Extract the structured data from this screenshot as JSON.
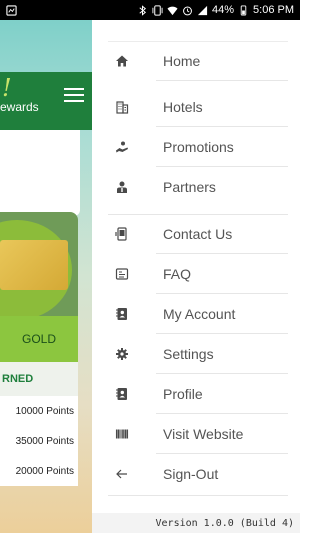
{
  "status_bar": {
    "battery": "44%",
    "time": "5:06 PM",
    "icons": [
      "notification-icon",
      "bluetooth-icon",
      "vibrate-icon",
      "wifi-icon",
      "alarm-icon",
      "signal-icon",
      "battery-icon"
    ]
  },
  "background": {
    "logo_text": "!",
    "brand_text": "ewards",
    "tier": "GOLD",
    "section_label": "RNED",
    "rows": [
      "10000 Points",
      "35000 Points",
      "20000 Points"
    ],
    "colors": {
      "header": "#1f7f3c",
      "tier": "#8cc63f"
    }
  },
  "drawer": {
    "items": [
      {
        "label": "Home",
        "icon": "home-icon"
      },
      {
        "label": "Hotels",
        "icon": "hotel-building-icon"
      },
      {
        "label": "Promotions",
        "icon": "promotion-hand-icon"
      },
      {
        "label": "Partners",
        "icon": "partner-person-icon"
      },
      {
        "label": "Contact Us",
        "icon": "contact-phone-icon"
      },
      {
        "label": "FAQ",
        "icon": "faq-icon"
      },
      {
        "label": "My Account",
        "icon": "account-book-icon"
      },
      {
        "label": "Settings",
        "icon": "gear-icon"
      },
      {
        "label": "Profile",
        "icon": "profile-card-icon"
      },
      {
        "label": "Visit Website",
        "icon": "barcode-icon"
      },
      {
        "label": "Sign-Out",
        "icon": "arrow-left-icon"
      }
    ],
    "version": "Version 1.0.0 (Build 4)",
    "icon_color": "#4a4a4a",
    "text_color": "#545454"
  }
}
